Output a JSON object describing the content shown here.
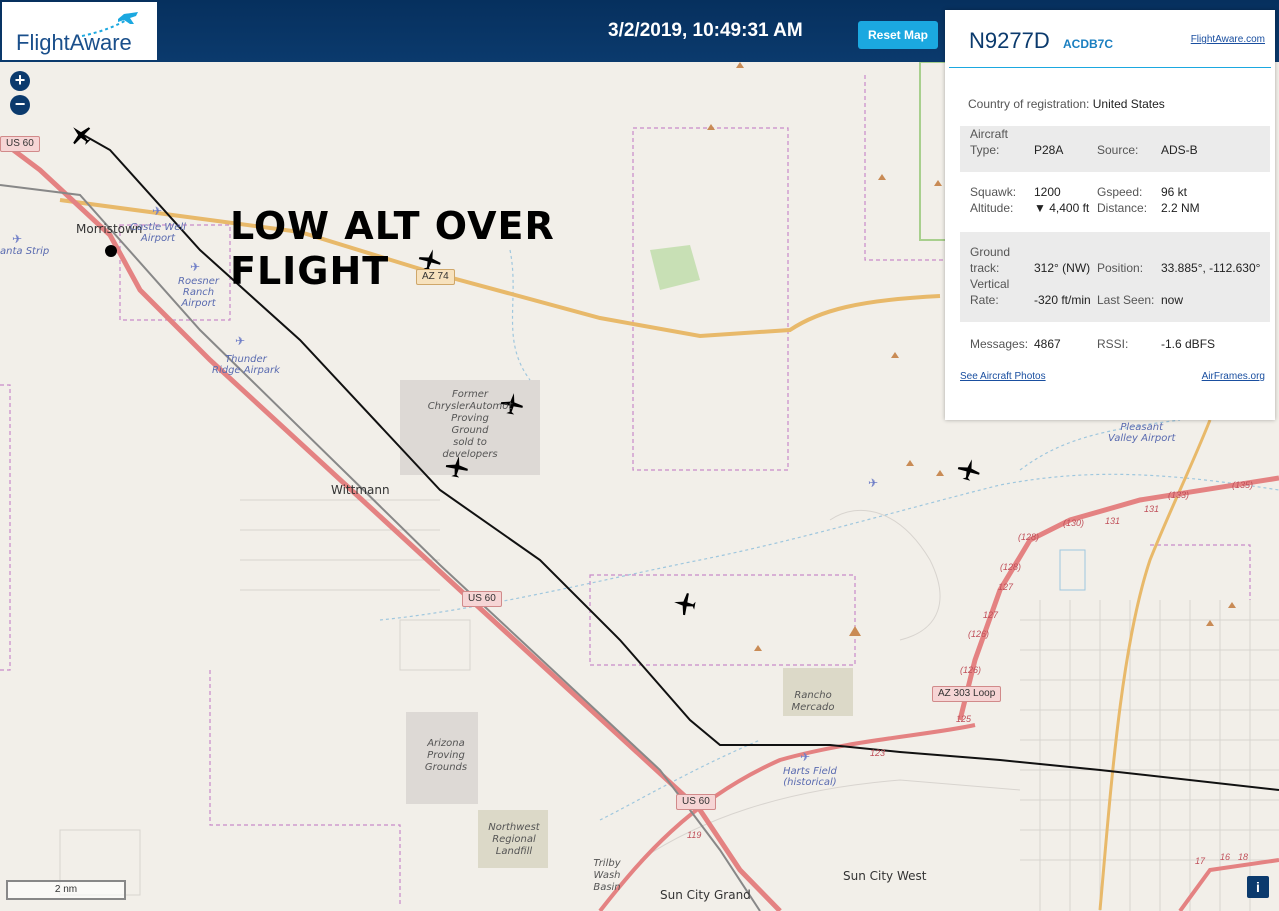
{
  "header": {
    "logo_text": "FlightAware",
    "datetime": "3/2/2019, 10:49:31 AM",
    "reset_label": "Reset Map"
  },
  "map": {
    "zoom_in": "+",
    "zoom_out": "−",
    "annotation_line1": "LOW ALT OVER",
    "annotation_line2": "FLIGHT",
    "scale_label": "2 nm",
    "info_label": "i",
    "towns": [
      "Morristown",
      "Wittmann",
      "Sun City Grand",
      "Sun City West"
    ],
    "airports": {
      "castle_well": [
        "Castle Well",
        "Airport"
      ],
      "roesner": [
        "Roesner",
        "Ranch",
        "Airport"
      ],
      "thunder_ridge": [
        "Thunder",
        "Ridge Airpark"
      ],
      "anta_strip": "anta Strip",
      "pleasant_valley": [
        "Pleasant",
        "Valley Airport"
      ],
      "harts_field": [
        "Harts Field",
        "(historical)"
      ]
    },
    "pois": {
      "proving_ground": [
        "Former",
        "ChryslerAutomot",
        "Proving",
        "Ground",
        "sold to",
        "developers"
      ],
      "arizona_proving": [
        "Arizona",
        "Proving",
        "Grounds"
      ],
      "rancho_mercado": [
        "Rancho",
        "Mercado"
      ],
      "landfill": [
        "Northwest",
        "Regional",
        "Landfill"
      ],
      "trilby": [
        "Trilby",
        "Wash",
        "Basin"
      ]
    },
    "roads": {
      "us60_a": "US 60",
      "us60_b": "US 60",
      "us60_c": "US 60",
      "az74": "AZ 74",
      "az303": "AZ 303 Loop"
    },
    "exits": [
      "(135)",
      "(133)",
      "131",
      "(130)",
      "131",
      "(128)",
      "(128)",
      "127",
      "127",
      "(126)",
      "(126)",
      "125",
      "123",
      "119",
      "17",
      "16",
      "18"
    ]
  },
  "panel": {
    "tail": "N9277D",
    "hex": "ACDB7C",
    "fa_link": "FlightAware.com",
    "country_label": "Country of registration:",
    "country_value": "United States",
    "aircraft_type_label": "Aircraft Type:",
    "aircraft_type_value": "P28A",
    "source_label": "Source:",
    "source_value": "ADS-B",
    "squawk_label": "Squawk:",
    "squawk_value": "1200",
    "gspeed_label": "Gspeed:",
    "gspeed_value": "96 kt",
    "altitude_label": "Altitude:",
    "altitude_value": "▼ 4,400 ft",
    "distance_label": "Distance:",
    "distance_value": "2.2 NM",
    "ground_track_label": "Ground track:",
    "ground_track_value": "312° (NW)",
    "position_label": "Position:",
    "position_value": "33.885°, -112.630°",
    "vertical_rate_label": "Vertical Rate:",
    "vertical_rate_value": "-320 ft/min",
    "last_seen_label": "Last Seen:",
    "last_seen_value": "now",
    "messages_label": "Messages:",
    "messages_value": "4867",
    "rssi_label": "RSSI:",
    "rssi_value": "-1.6 dBFS",
    "photos_link": "See Aircraft Photos",
    "airframes_link": "AirFrames.org"
  }
}
